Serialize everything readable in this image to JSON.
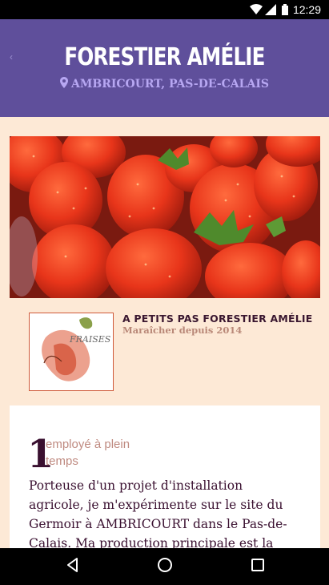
{
  "status_bar": {
    "time": "12:29"
  },
  "header": {
    "title": "FORESTIER AMÉLIE",
    "location": "AMBRICOURT, PAS-DE-CALAIS"
  },
  "farm": {
    "name": "A PETITS PAS FORESTIER AMÉLIE",
    "since": "Maraîcher depuis 2014",
    "logo_text": "FRAISES BI"
  },
  "employees": {
    "count": "1",
    "label": "employé à plein temps"
  },
  "description": "Porteuse d'un projet d'installation agricole, je m'expérimente sur le site du Germoir à AMBRICOURT dans le Pas-de-Calais. Ma production principale est la fraise",
  "colors": {
    "header_bg": "#5f4f9b",
    "page_bg": "#fde9d6",
    "accent_text": "#3a1030"
  }
}
